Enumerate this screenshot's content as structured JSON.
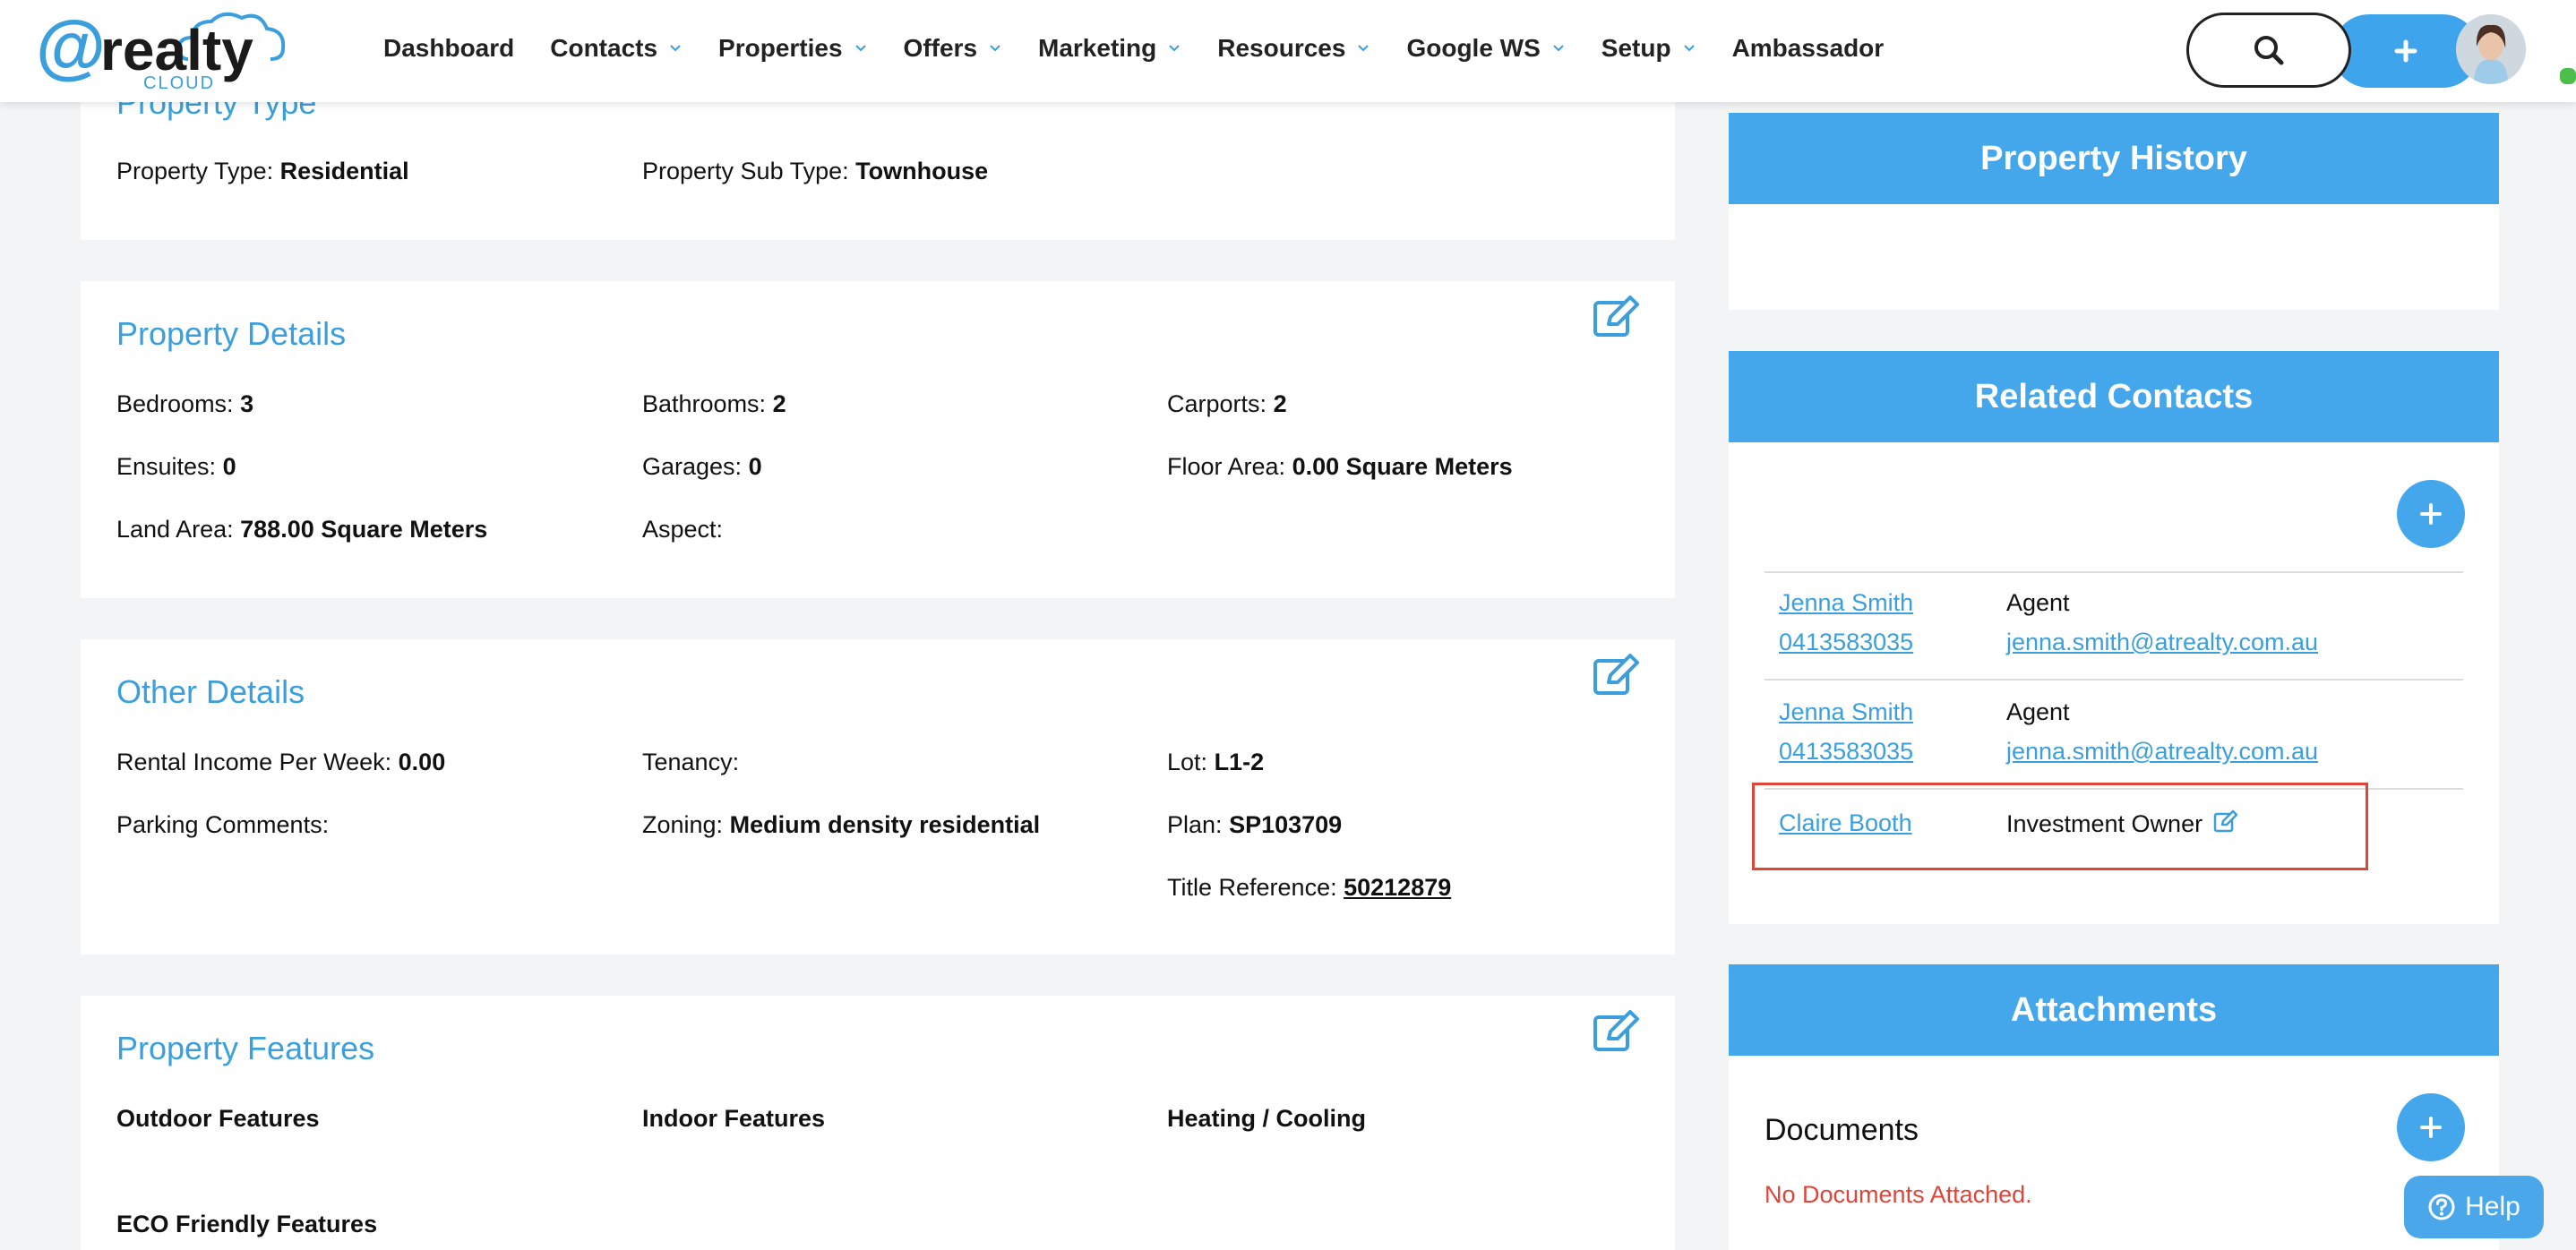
{
  "app": {
    "logo_text": "realty",
    "logo_at": "@",
    "logo_sub": "CLOUD"
  },
  "nav": {
    "items": [
      {
        "label": "Dashboard",
        "dropdown": false
      },
      {
        "label": "Contacts",
        "dropdown": true
      },
      {
        "label": "Properties",
        "dropdown": true
      },
      {
        "label": "Offers",
        "dropdown": true
      },
      {
        "label": "Marketing",
        "dropdown": true
      },
      {
        "label": "Resources",
        "dropdown": true
      },
      {
        "label": "Google WS",
        "dropdown": true
      },
      {
        "label": "Setup",
        "dropdown": true
      },
      {
        "label": "Ambassador",
        "dropdown": false
      }
    ],
    "search_icon": "search-icon",
    "add_icon": "plus-icon",
    "accent": "#3ea4ec"
  },
  "property_type": {
    "title": "Property Type",
    "type_label": "Property Type:",
    "type_value": "Residential",
    "subtype_label": "Property Sub Type:",
    "subtype_value": "Townhouse"
  },
  "property_details": {
    "title": "Property Details",
    "bedrooms_label": "Bedrooms:",
    "bedrooms_value": "3",
    "bathrooms_label": "Bathrooms:",
    "bathrooms_value": "2",
    "carports_label": "Carports:",
    "carports_value": "2",
    "ensuites_label": "Ensuites:",
    "ensuites_value": "0",
    "garages_label": "Garages:",
    "garages_value": "0",
    "floor_label": "Floor Area:",
    "floor_value": "0.00 Square Meters",
    "land_label": "Land Area:",
    "land_value": "788.00 Square Meters",
    "aspect_label": "Aspect:",
    "aspect_value": ""
  },
  "other_details": {
    "title": "Other Details",
    "rental_label": "Rental Income Per Week:",
    "rental_value": "0.00",
    "tenancy_label": "Tenancy:",
    "tenancy_value": "",
    "lot_label": "Lot:",
    "lot_value": "L1-2",
    "parking_label": "Parking Comments:",
    "parking_value": "",
    "zoning_label": "Zoning:",
    "zoning_value": "Medium density residential",
    "plan_label": "Plan:",
    "plan_value": "SP103709",
    "title_ref_label": "Title Reference:",
    "title_ref_value": "50212879"
  },
  "property_features": {
    "title": "Property Features",
    "outdoor": "Outdoor Features",
    "indoor": "Indoor Features",
    "heating": "Heating / Cooling",
    "eco": "ECO Friendly Features"
  },
  "property_history": {
    "title": "Property History"
  },
  "related_contacts": {
    "title": "Related Contacts",
    "contacts": [
      {
        "name": "Jenna Smith",
        "phone": "0413583035",
        "role": "Agent",
        "email": "jenna.smith@atrealty.com.au"
      },
      {
        "name": "Jenna Smith",
        "phone": "0413583035",
        "role": "Agent",
        "email": "jenna.smith@atrealty.com.au"
      },
      {
        "name": "Claire Booth",
        "role": "Investment Owner"
      }
    ]
  },
  "attachments": {
    "title": "Attachments",
    "documents_label": "Documents",
    "empty_text": "No Documents Attached."
  },
  "help": {
    "label": "Help"
  },
  "colors": {
    "accent": "#44a7ec",
    "link": "#3a9fdc",
    "error": "#e0453a",
    "highlight": "#e0453a"
  }
}
